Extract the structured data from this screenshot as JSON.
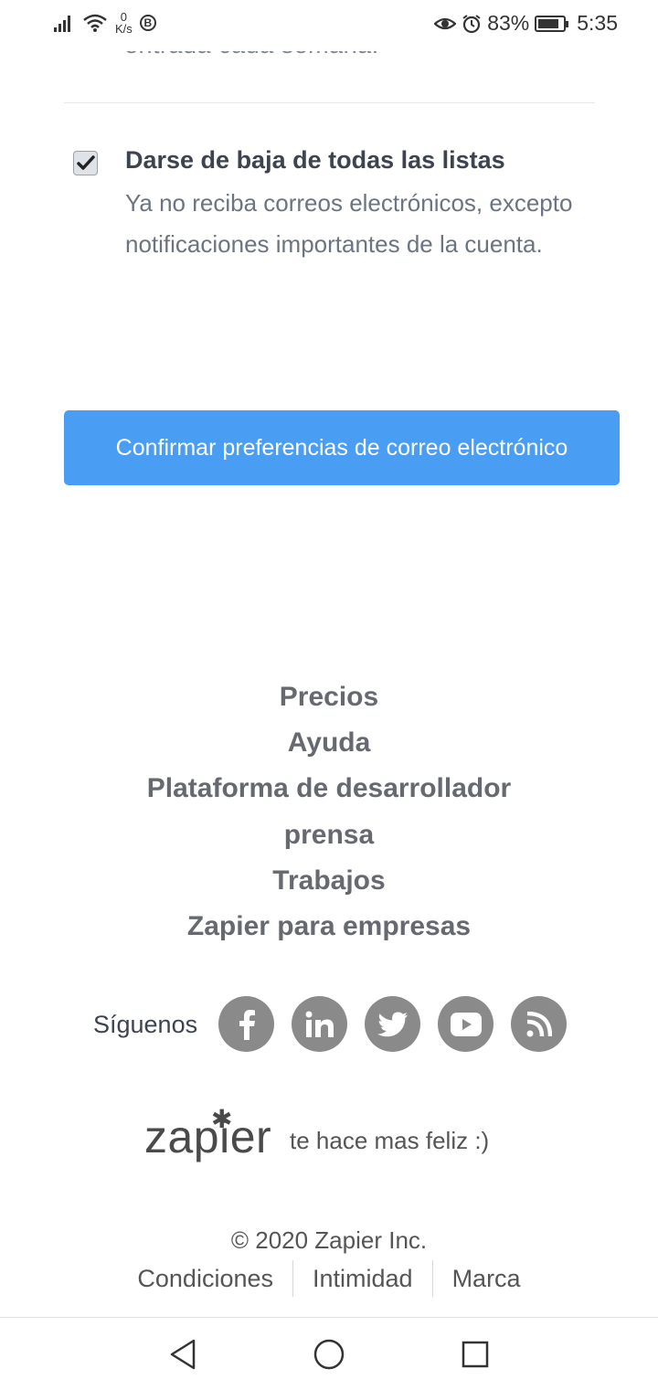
{
  "status_bar": {
    "net_speed_value": "0",
    "net_speed_unit": "K/s",
    "battery": "83%",
    "time": "5:35",
    "icons": [
      "signal-icon",
      "wifi-icon",
      "b-icon",
      "eye-icon",
      "alarm-icon",
      "battery-icon"
    ]
  },
  "cut_off_text": "entrada cada semana.",
  "unsubscribe_option": {
    "checked": true,
    "title": "Darse de baja de todas las listas",
    "description": "Ya no reciba correos electrónicos, excepto notificaciones importantes de la cuenta."
  },
  "confirm_button": "Confirmar preferencias de correo electrónico",
  "footer_links": [
    "Precios",
    "Ayuda",
    "Plataforma de desarrollador",
    "prensa",
    "Trabajos",
    "Zapier para empresas"
  ],
  "social": {
    "label": "Síguenos",
    "icons": [
      "facebook-icon",
      "linkedin-icon",
      "twitter-icon",
      "youtube-icon",
      "rss-icon"
    ]
  },
  "brand": {
    "logo_text": "zapier",
    "tagline": "te hace mas feliz :)"
  },
  "copyright": "© 2020 Zapier Inc.",
  "legal_links": [
    "Condiciones",
    "Intimidad",
    "Marca"
  ],
  "colors": {
    "accent": "#499df3",
    "footer_text": "#666a70",
    "social_bg": "#8a8a8a"
  }
}
